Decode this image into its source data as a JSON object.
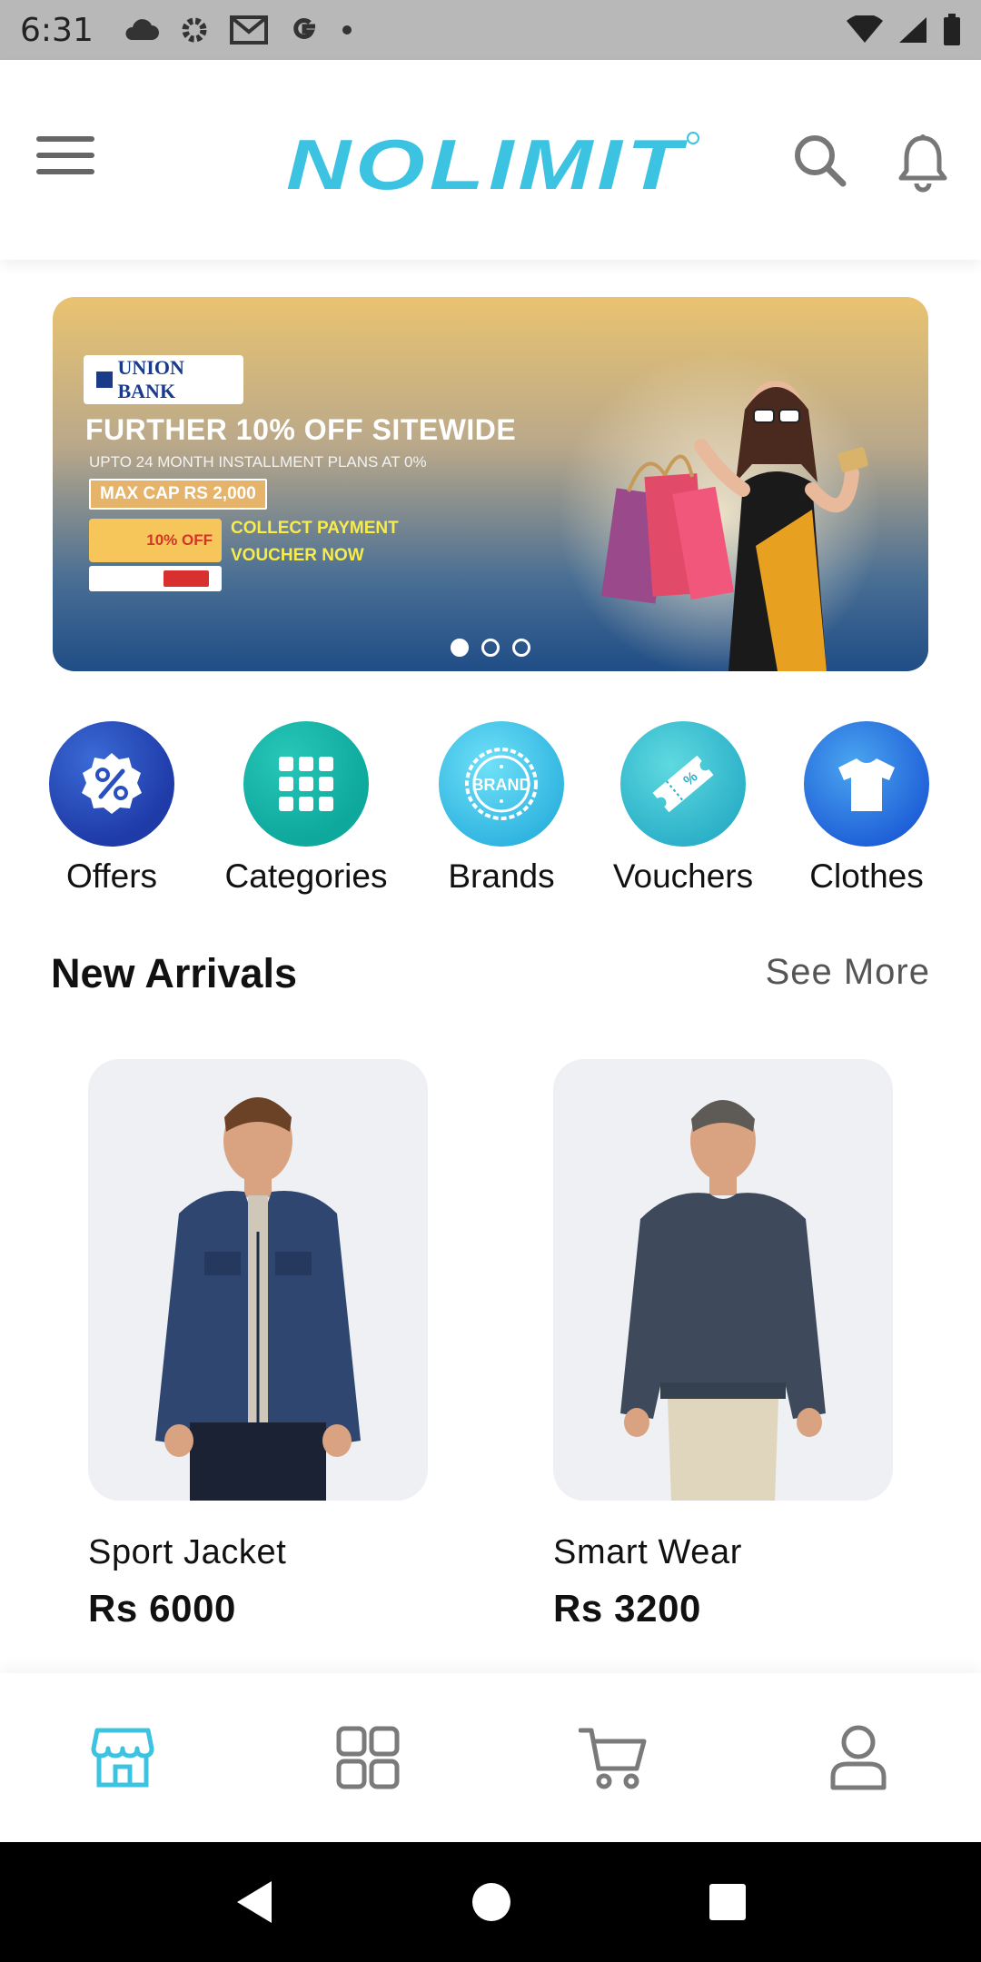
{
  "status_bar": {
    "time": "6:31",
    "icons_left": [
      "cloud-icon",
      "gear-icon",
      "gmail-icon",
      "google-icon",
      "dot-icon"
    ],
    "icons_right": [
      "wifi-icon",
      "signal-icon",
      "battery-icon"
    ]
  },
  "app_bar": {
    "logo_text": "NOLIMIT",
    "brand_color": "#3cc3e2",
    "icons": [
      "menu-icon",
      "search-icon",
      "bell-icon"
    ]
  },
  "banner": {
    "bank_name": "UNION BANK",
    "headline": "FURTHER 10% OFF SITEWIDE",
    "subline": "UPTO 24 MONTH INSTALLMENT PLANS AT 0%",
    "max_cap": "MAX CAP RS 2,000",
    "voucher_off": "10% OFF",
    "collect_line1": "COLLECT PAYMENT",
    "collect_line2": "VOUCHER NOW",
    "slides": 3,
    "active_slide": 1
  },
  "categories": [
    {
      "label": "Offers",
      "icon": "percent-badge-icon"
    },
    {
      "label": "Categories",
      "icon": "grid-dots-icon"
    },
    {
      "label": "Brands",
      "icon": "brand-badge-icon"
    },
    {
      "label": "Vouchers",
      "icon": "ticket-icon"
    },
    {
      "label": "Clothes",
      "icon": "tshirt-icon"
    }
  ],
  "brand_badge_text": "BRAND",
  "new_arrivals": {
    "title": "New Arrivals",
    "see_more": "See More",
    "products": [
      {
        "name": "Sport Jacket",
        "price": "Rs 6000"
      },
      {
        "name": "Smart Wear",
        "price": "Rs 3200"
      }
    ]
  },
  "bottom_nav": {
    "items": [
      "store-icon",
      "grid-icon",
      "cart-icon",
      "profile-icon"
    ],
    "active": "store-icon",
    "active_color": "#3cc3e2",
    "inactive_color": "#7a7a7a"
  },
  "system_nav": [
    "back-icon",
    "home-icon",
    "recents-icon"
  ]
}
